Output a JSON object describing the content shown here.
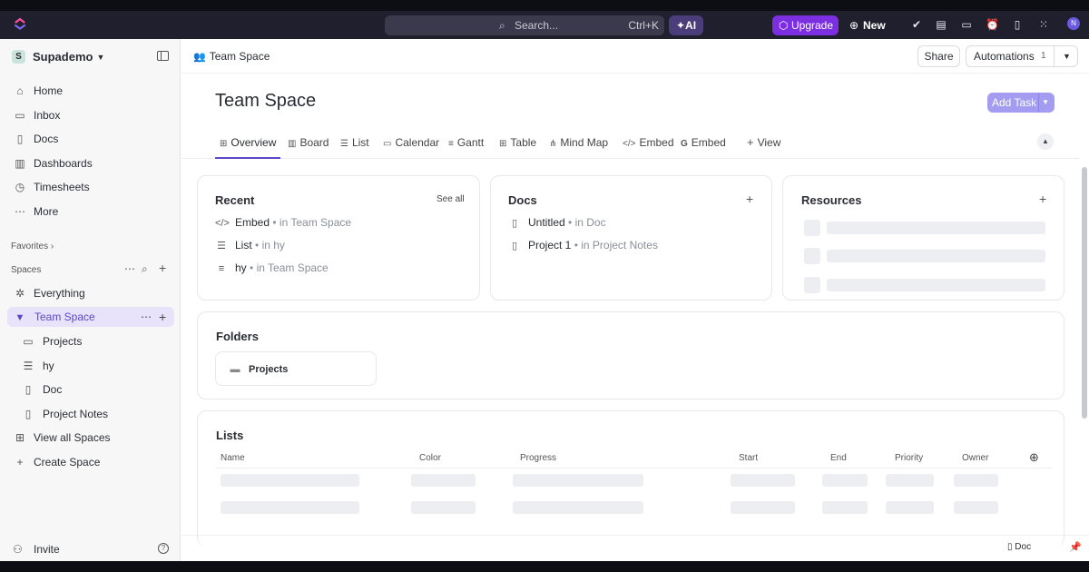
{
  "topbar": {
    "search_placeholder": "Search...",
    "search_shortcut": "Ctrl+K",
    "ai_label": "AI",
    "upgrade_label": "Upgrade",
    "new_label": "New",
    "avatar_initial": "N",
    "icons": [
      "check-circle-icon",
      "notepad-icon",
      "video-icon",
      "alarm-icon",
      "document-icon",
      "apps-grid-icon"
    ]
  },
  "sidebar": {
    "workspace_badge": "S",
    "workspace_name": "Supademo",
    "nav": [
      {
        "label": "Home",
        "icon": "home-icon"
      },
      {
        "label": "Inbox",
        "icon": "inbox-icon"
      },
      {
        "label": "Docs",
        "icon": "docs-icon"
      },
      {
        "label": "Dashboards",
        "icon": "dashboards-icon"
      },
      {
        "label": "Timesheets",
        "icon": "timesheets-icon"
      },
      {
        "label": "More",
        "icon": "more-icon"
      }
    ],
    "favorites_label": "Favorites",
    "spaces_label": "Spaces",
    "everything_label": "Everything",
    "active_space": "Team Space",
    "children": [
      "Projects",
      "hy",
      "Doc",
      "Project Notes"
    ],
    "view_all_label": "View all Spaces",
    "create_label": "Create Space",
    "invite_label": "Invite"
  },
  "header": {
    "breadcrumb": "Team Space",
    "share_label": "Share",
    "automations_label": "Automations",
    "automations_count": "1",
    "page_title": "Team Space",
    "add_task_label": "Add Task"
  },
  "tabs": [
    {
      "label": "Overview",
      "icon": "overview-icon",
      "active": true
    },
    {
      "label": "Board",
      "icon": "board-icon"
    },
    {
      "label": "List",
      "icon": "list-icon"
    },
    {
      "label": "Calendar",
      "icon": "calendar-icon"
    },
    {
      "label": "Gantt",
      "icon": "gantt-icon"
    },
    {
      "label": "Table",
      "icon": "table-icon"
    },
    {
      "label": "Mind Map",
      "icon": "mindmap-icon"
    },
    {
      "label": "Embed",
      "icon": "code-icon"
    },
    {
      "label": "Embed",
      "icon": "google-icon"
    },
    {
      "label": "View",
      "icon": "plus-icon"
    }
  ],
  "recent": {
    "title": "Recent",
    "see_all": "See all",
    "items": [
      {
        "name": "Embed",
        "loc": "in Team Space"
      },
      {
        "name": "List",
        "loc": "in hy"
      },
      {
        "name": "hy",
        "loc": "in Team Space"
      }
    ]
  },
  "docs": {
    "title": "Docs",
    "items": [
      {
        "name": "Untitled",
        "loc": "in Doc"
      },
      {
        "name": "Project 1",
        "loc": "in Project Notes"
      }
    ]
  },
  "resources": {
    "title": "Resources"
  },
  "folders": {
    "title": "Folders",
    "item": "Projects"
  },
  "lists": {
    "title": "Lists",
    "columns": [
      "Name",
      "Color",
      "Progress",
      "Start",
      "End",
      "Priority",
      "Owner"
    ]
  },
  "footer": {
    "doc_label": "Doc"
  }
}
